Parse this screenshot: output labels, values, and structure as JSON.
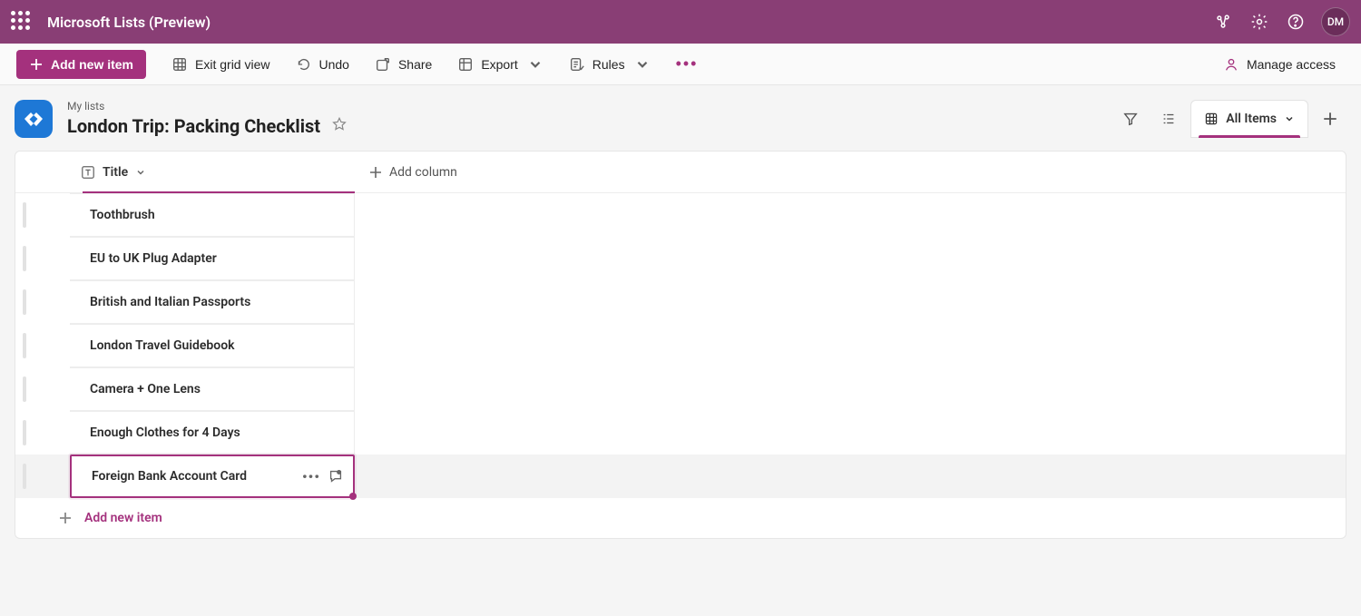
{
  "header": {
    "app_title": "Microsoft Lists (Preview)",
    "avatar_initials": "DM"
  },
  "cmd": {
    "add_item": "Add new item",
    "exit_grid": "Exit grid view",
    "undo": "Undo",
    "share": "Share",
    "export": "Export",
    "rules": "Rules",
    "manage_access": "Manage access"
  },
  "list": {
    "breadcrumb": "My lists",
    "name": "London Trip: Packing Checklist",
    "view_label": "All Items"
  },
  "columns": {
    "title": "Title",
    "add_column": "Add column"
  },
  "rows": [
    {
      "title": "Toothbrush"
    },
    {
      "title": "EU to UK Plug Adapter"
    },
    {
      "title": "British and Italian Passports"
    },
    {
      "title": "London Travel Guidebook"
    },
    {
      "title": "Camera + One Lens"
    },
    {
      "title": "Enough Clothes for 4 Days"
    },
    {
      "title": "Foreign Bank Account Card"
    }
  ],
  "selected_index": 6,
  "footer": {
    "add_item": "Add new item"
  }
}
